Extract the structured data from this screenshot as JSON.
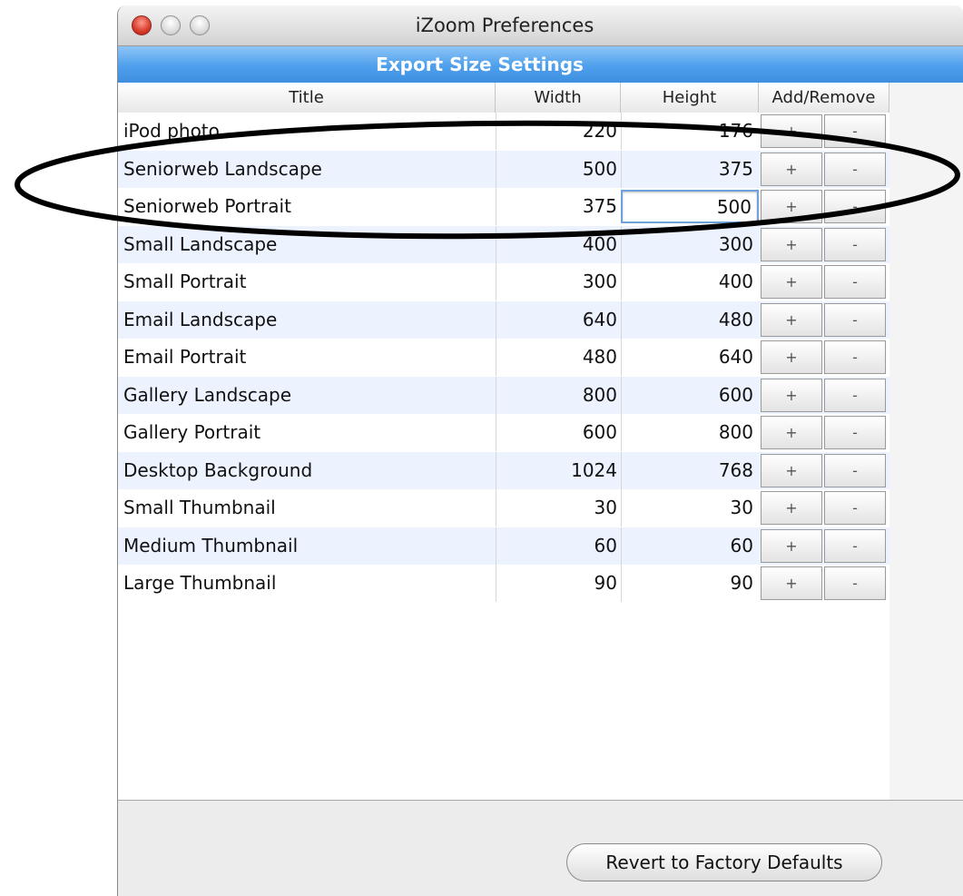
{
  "window": {
    "title": "iZoom Preferences"
  },
  "section": {
    "title": "Export Size Settings"
  },
  "table": {
    "headers": {
      "title": "Title",
      "width": "Width",
      "height": "Height",
      "add_remove": "Add/Remove"
    },
    "rows": [
      {
        "title": "iPod photo",
        "width": "220",
        "height": "176",
        "add": "+",
        "remove": "-"
      },
      {
        "title": "Seniorweb Landscape",
        "width": "500",
        "height": "375",
        "add": "+",
        "remove": "-"
      },
      {
        "title": "Seniorweb Portrait",
        "width": "375",
        "height": "500",
        "add": "+",
        "remove": "-"
      },
      {
        "title": "Small Landscape",
        "width": "400",
        "height": "300",
        "add": "+",
        "remove": "-"
      },
      {
        "title": "Small Portrait",
        "width": "300",
        "height": "400",
        "add": "+",
        "remove": "-"
      },
      {
        "title": "Email Landscape",
        "width": "640",
        "height": "480",
        "add": "+",
        "remove": "-"
      },
      {
        "title": "Email Portrait",
        "width": "480",
        "height": "640",
        "add": "+",
        "remove": "-"
      },
      {
        "title": "Gallery Landscape",
        "width": "800",
        "height": "600",
        "add": "+",
        "remove": "-"
      },
      {
        "title": "Gallery Portrait",
        "width": "600",
        "height": "800",
        "add": "+",
        "remove": "-"
      },
      {
        "title": "Desktop Background",
        "width": "1024",
        "height": "768",
        "add": "+",
        "remove": "-"
      },
      {
        "title": "Small Thumbnail",
        "width": "30",
        "height": "30",
        "add": "+",
        "remove": "-"
      },
      {
        "title": "Medium Thumbnail",
        "width": "60",
        "height": "60",
        "add": "+",
        "remove": "-"
      },
      {
        "title": "Large Thumbnail",
        "width": "90",
        "height": "90",
        "add": "+",
        "remove": "-"
      }
    ]
  },
  "footer": {
    "revert_label": "Revert to Factory Defaults"
  },
  "colors": {
    "section_bar": "#4e9fec",
    "row_alt": "#edf3fe",
    "close_button": "#d63a2a"
  }
}
